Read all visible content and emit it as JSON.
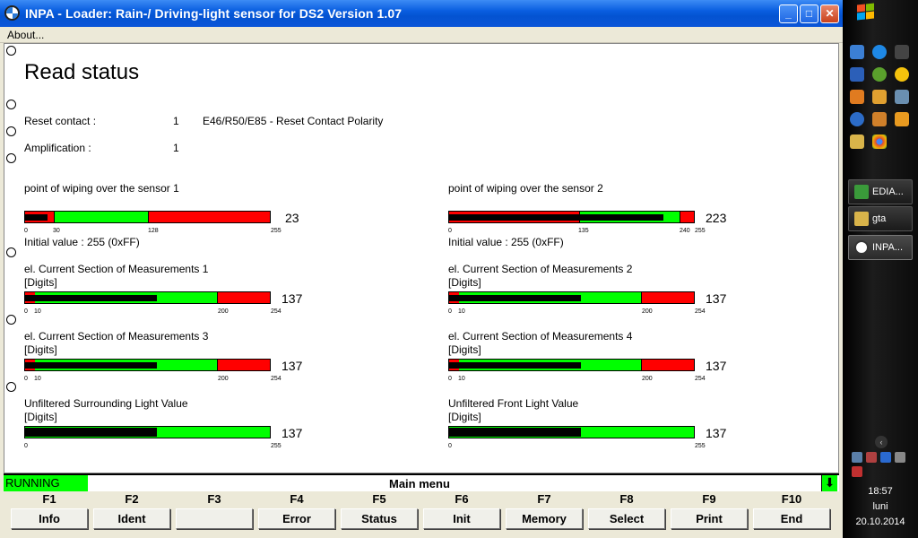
{
  "window": {
    "title": "INPA - Loader:  Rain-/ Driving-light sensor for DS2 Version 1.07",
    "minimize": "_",
    "maximize": "□",
    "close": "✕"
  },
  "menu": {
    "about": "About..."
  },
  "page": {
    "title": "Read status"
  },
  "reset": {
    "label": "Reset contact :",
    "value": "1",
    "note": "E46/R50/E85 - Reset Contact Polarity"
  },
  "amplification": {
    "label": "Amplification :",
    "value": "1"
  },
  "meters": {
    "wipe1": {
      "title": "point of wiping over the sensor 1",
      "value": "23",
      "value_num": 23,
      "threshold_low": 30,
      "threshold_high": 128,
      "max": 255,
      "scale": [
        "0",
        "30",
        "128",
        "255"
      ],
      "initial": "Initial value : 255 (0xFF)"
    },
    "wipe2": {
      "title": "point of wiping over the sensor 2",
      "value": "223",
      "value_num": 223,
      "threshold_low": 135,
      "threshold_high": 240,
      "max": 255,
      "scale": [
        "0",
        "135",
        "240",
        "255"
      ],
      "initial": "Initial value : 255 (0xFF)"
    },
    "current1": {
      "title": "el. Current Section of Measurements 1",
      "unit": "[Digits]",
      "value": "137",
      "value_num": 137,
      "threshold_low": 10,
      "threshold_high": 200,
      "max": 255,
      "scale": [
        "0",
        "10",
        "200",
        "254"
      ]
    },
    "current2": {
      "title": "el. Current Section of Measurements 2",
      "unit": "[Digits]",
      "value": "137",
      "value_num": 137,
      "threshold_low": 10,
      "threshold_high": 200,
      "max": 255,
      "scale": [
        "0",
        "10",
        "200",
        "254"
      ]
    },
    "current3": {
      "title": "el. Current Section of Measurements 3",
      "unit": "[Digits]",
      "value": "137",
      "value_num": 137,
      "threshold_low": 10,
      "threshold_high": 200,
      "max": 255,
      "scale": [
        "0",
        "10",
        "200",
        "254"
      ]
    },
    "current4": {
      "title": "el. Current Section of Measurements 4",
      "unit": "[Digits]",
      "value": "137",
      "value_num": 137,
      "threshold_low": 10,
      "threshold_high": 200,
      "max": 255,
      "scale": [
        "0",
        "10",
        "200",
        "254"
      ]
    },
    "surround": {
      "title": "Unfiltered Surrounding Light Value",
      "unit": "[Digits]",
      "value": "137",
      "value_num": 137,
      "max": 255,
      "scale": [
        "0",
        "255"
      ]
    },
    "front": {
      "title": "Unfiltered Front Light Value",
      "unit": "[Digits]",
      "value": "137",
      "value_num": 137,
      "max": 255,
      "scale": [
        "0",
        "255"
      ]
    }
  },
  "colors": {
    "green": "#00ff00",
    "red": "#ff0000",
    "fill": "#000000"
  },
  "status": {
    "running": "RUNNING",
    "main_menu": "Main menu",
    "arrow": "⬇"
  },
  "fkeys": [
    {
      "key": "F1",
      "label": "Info"
    },
    {
      "key": "F2",
      "label": "Ident"
    },
    {
      "key": "F3",
      "label": ""
    },
    {
      "key": "F4",
      "label": "Error"
    },
    {
      "key": "F5",
      "label": "Status"
    },
    {
      "key": "F6",
      "label": "Init"
    },
    {
      "key": "F7",
      "label": "Memory"
    },
    {
      "key": "F8",
      "label": "Select"
    },
    {
      "key": "F9",
      "label": "Print"
    },
    {
      "key": "F10",
      "label": "End"
    }
  ],
  "taskbar": {
    "tasks": [
      {
        "label": "EDIA..."
      },
      {
        "label": "gta"
      },
      {
        "label": "INPA..."
      }
    ],
    "clock": {
      "time": "18:57",
      "day": "luni",
      "date": "20.10.2014"
    },
    "tray_expand": "‹"
  }
}
